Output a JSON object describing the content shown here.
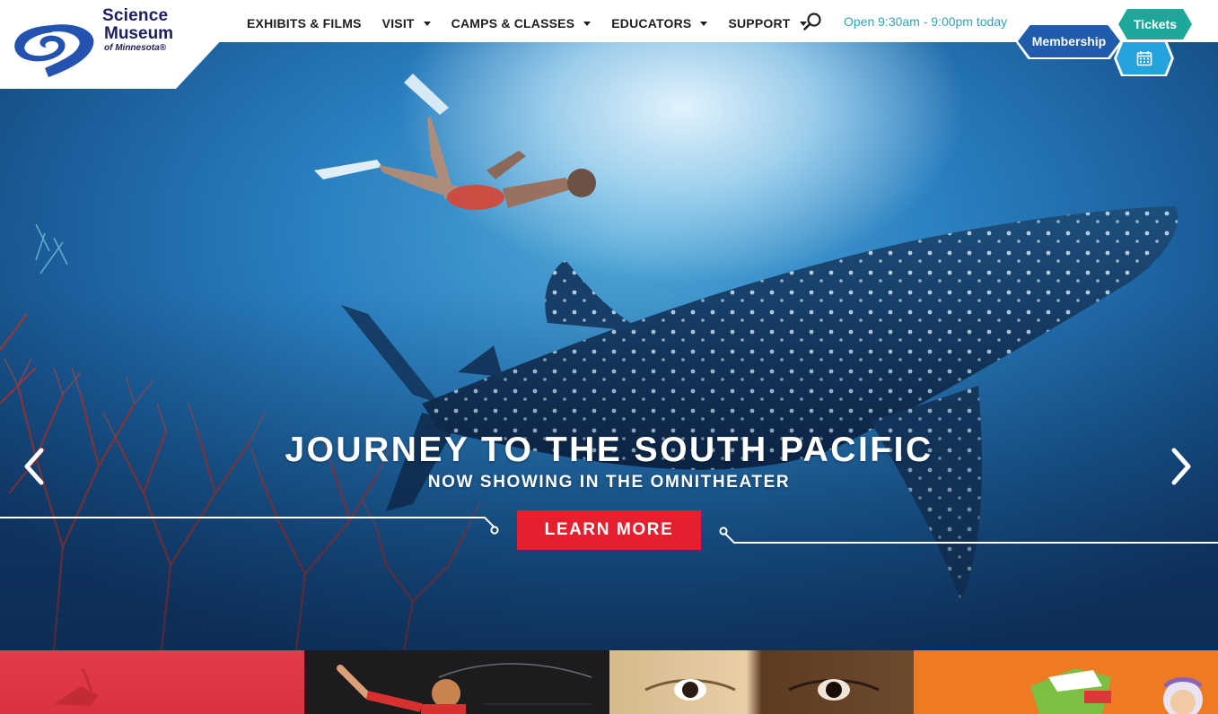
{
  "logo": {
    "line1": "Science",
    "line2": "Museum",
    "line3": "of Minnesota®",
    "icon": "swirl-logo-icon"
  },
  "nav": {
    "items": [
      {
        "label": "EXHIBITS & FILMS",
        "dropdown": false
      },
      {
        "label": "VISIT",
        "dropdown": true
      },
      {
        "label": "CAMPS & CLASSES",
        "dropdown": true
      },
      {
        "label": "EDUCATORS",
        "dropdown": true
      },
      {
        "label": "SUPPORT",
        "dropdown": true
      }
    ],
    "search_icon": "search-icon",
    "hours": "Open 9:30am - 9:00pm today"
  },
  "actions": {
    "tickets": "Tickets",
    "membership": "Membership",
    "calendar_icon": "calendar-icon"
  },
  "hero": {
    "title": "JOURNEY TO THE SOUTH PACIFIC",
    "subtitle": "NOW SHOWING IN THE OMNITHEATER",
    "cta": "LEARN MORE",
    "prev_icon": "chevron-left-icon",
    "next_icon": "chevron-right-icon"
  },
  "colors": {
    "navy": "#1c1f5e",
    "teal": "#1ea89a",
    "blue": "#1f5cab",
    "sky": "#26a3dd",
    "hours_text": "#2fa3b8",
    "cta_red": "#e5202e",
    "tile_red": "#e23c4a",
    "tile_orange": "#ee7a23"
  }
}
